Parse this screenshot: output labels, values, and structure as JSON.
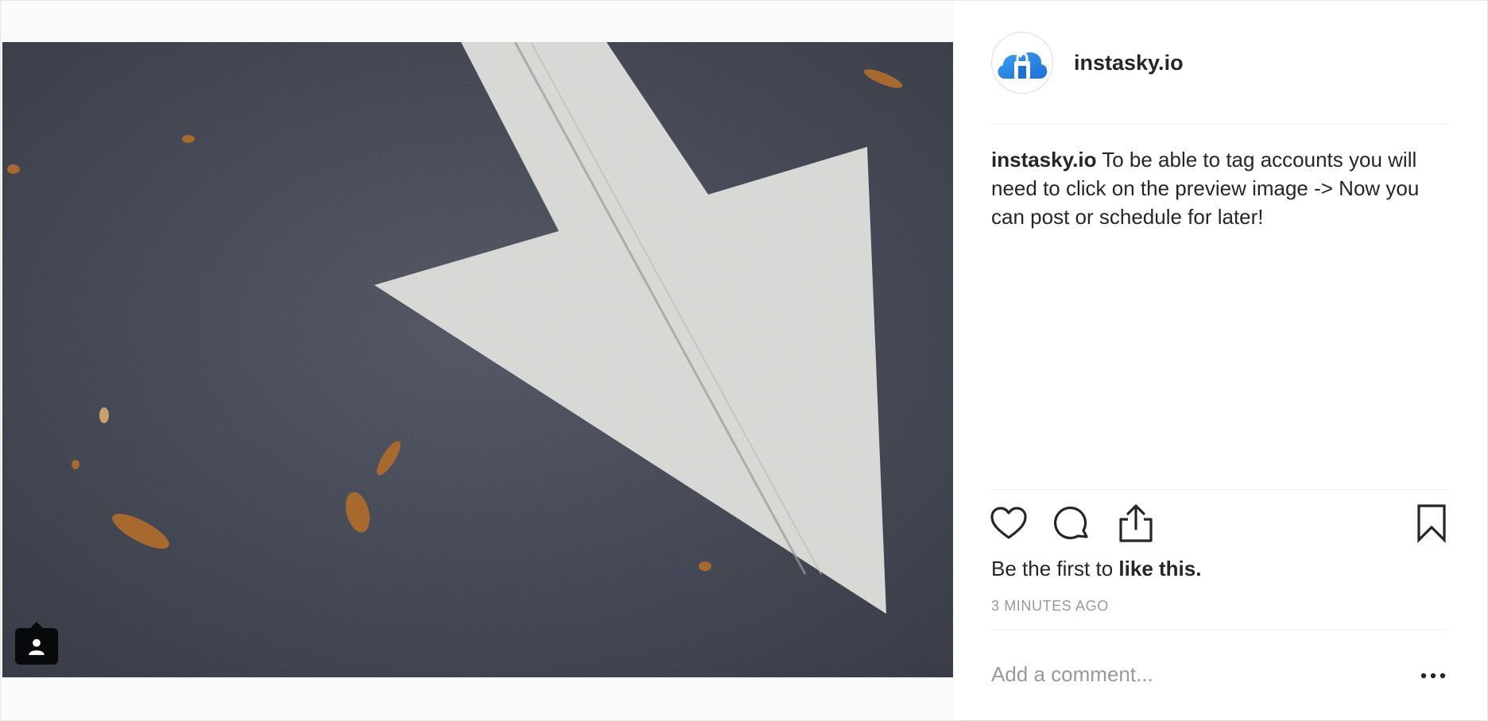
{
  "post": {
    "author": {
      "username": "instasky.io",
      "avatar_icon": "cloud-bag-logo"
    },
    "caption": {
      "username": "instasky.io",
      "text": " To be able to tag accounts you will need to click on the preview image -> Now you can post or schedule for later!"
    },
    "media": {
      "description_icon": "photo",
      "tag_icon": "user-tag-icon"
    },
    "actions": {
      "like_icon": "heart-icon",
      "comment_icon": "comment-icon",
      "share_icon": "share-icon",
      "save_icon": "bookmark-icon"
    },
    "likes": {
      "prefix": "Be the first to ",
      "link": "like this."
    },
    "timestamp": "3 MINUTES AGO",
    "comment": {
      "placeholder": "Add a comment...",
      "more_icon": "more-options-icon"
    }
  },
  "colors": {
    "text_primary": "#262626",
    "text_secondary": "#999999",
    "divider": "#efefef",
    "brand_blue": "#2f8fe8"
  }
}
